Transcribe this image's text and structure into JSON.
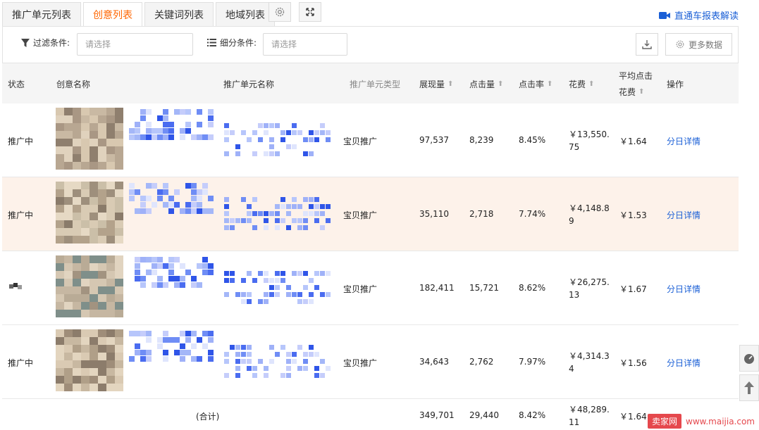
{
  "tabs": [
    {
      "label": "推广单元列表",
      "active": false
    },
    {
      "label": "创意列表",
      "active": true
    },
    {
      "label": "关键词列表",
      "active": false
    },
    {
      "label": "地域列表",
      "active": false
    }
  ],
  "toolbar": {
    "settings_icon": "gear-icon",
    "fullscreen_icon": "fullscreen-icon"
  },
  "report_link": {
    "label": "直通车报表解读",
    "icon": "video-camera-icon",
    "color": "#1a5fd6"
  },
  "filters": {
    "filter_label": "过滤条件:",
    "filter_placeholder": "请选择",
    "segment_label": "细分条件:",
    "segment_placeholder": "请选择",
    "more_data_label": "更多数据"
  },
  "table": {
    "headers": {
      "status": "状态",
      "creative": "创意名称",
      "unit": "推广单元名称",
      "unit_type": "推广单元类型",
      "impressions": "展现量",
      "clicks": "点击量",
      "ctr": "点击率",
      "cost": "花费",
      "avg_cpc_line1": "平均点击",
      "avg_cpc_line2": "花费",
      "action": "操作"
    },
    "rows": [
      {
        "status": "推广中",
        "unit_type": "宝贝推广",
        "impressions": "97,537",
        "clicks": "8,239",
        "ctr": "8.45%",
        "cost_line1": "￥13,550.",
        "cost_line2": "75",
        "avg_cpc": "￥1.64",
        "action": "分日详情"
      },
      {
        "status": "推广中",
        "unit_type": "宝贝推广",
        "impressions": "35,110",
        "clicks": "2,718",
        "ctr": "7.74%",
        "cost_line1": "￥4,148.8",
        "cost_line2": "9",
        "avg_cpc": "￥1.53",
        "action": "分日详情"
      },
      {
        "status": "",
        "unit_type": "宝贝推广",
        "impressions": "182,411",
        "clicks": "15,721",
        "ctr": "8.62%",
        "cost_line1": "￥26,275.",
        "cost_line2": "13",
        "avg_cpc": "￥1.67",
        "action": "分日详情"
      },
      {
        "status": "推广中",
        "unit_type": "宝贝推广",
        "impressions": "34,643",
        "clicks": "2,762",
        "ctr": "7.97%",
        "cost_line1": "￥4,314.3",
        "cost_line2": "4",
        "avg_cpc": "￥1.56",
        "action": "分日详情"
      }
    ],
    "total": {
      "label": "(合计)",
      "impressions": "349,701",
      "clicks": "29,440",
      "ctr": "8.42%",
      "cost_line1": "￥48,289.",
      "cost_line2": "11",
      "avg_cpc": "￥1.64"
    }
  },
  "watermark": {
    "badge": "卖家网",
    "url": "www.maijia.com"
  },
  "colors": {
    "active_tab": "#ff6600",
    "link": "#1a5fd6",
    "highlight_row": "#fdf2ea",
    "header_bg": "#f5f5f5"
  }
}
